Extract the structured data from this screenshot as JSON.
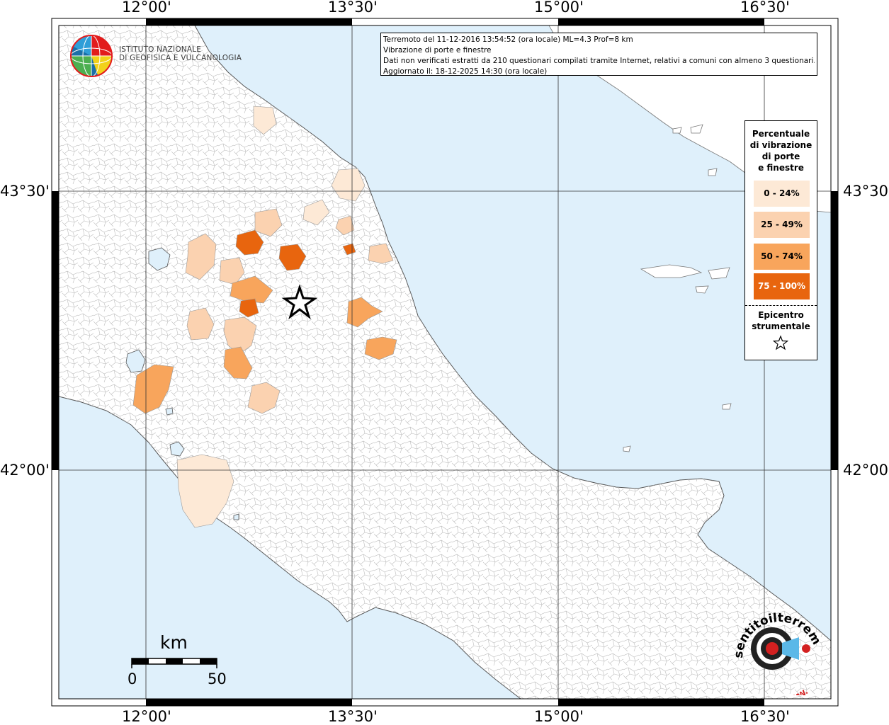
{
  "title_box": {
    "line1": "Terremoto del 11-12-2016 13:54:52 (ora locale) ML=4.3 Prof=8 km",
    "line2": "Vibrazione di porte e finestre",
    "line3": "Dati non verificati estratti da 210 questionari compilati tramite Internet, relativi a comuni con almeno 3 questionari.",
    "line4": "Aggiornato il: 18-12-2025 14:30 (ora locale)"
  },
  "logo": {
    "line1": "ISTITUTO NAZIONALE",
    "line2": "DI GEOFISICA E VULCANOLOGIA"
  },
  "axes": {
    "top": [
      "12°00'",
      "13°30'",
      "15°00'",
      "16°30'"
    ],
    "bottom": [
      "12°00'",
      "13°30'",
      "15°00'",
      "16°30'"
    ],
    "left": [
      "43°30'",
      "42°00'"
    ],
    "right": [
      "43°30'",
      "42°00'"
    ]
  },
  "legend": {
    "title": [
      "Percentuale",
      "di vibrazione",
      "di porte",
      "e finestre"
    ],
    "classes": [
      {
        "label": "0 - 24%",
        "color": "#fde9d6"
      },
      {
        "label": "25 - 49%",
        "color": "#fbd2b0"
      },
      {
        "label": "50 - 74%",
        "color": "#f8a55c"
      },
      {
        "label": "75 - 100%",
        "color": "#e8650e"
      }
    ],
    "epicenter_title": [
      "Epicentro",
      "strumentale"
    ],
    "epicenter_symbol": "star-icon"
  },
  "scale_bar": {
    "unit": "km",
    "min_label": "0",
    "max_label": "50"
  },
  "badge": {
    "text": "sentitoilterremoto.it",
    "www": "WWW."
  },
  "colors": {
    "sea": "#dff0fb",
    "land": "#ffffff",
    "boundary": "#b5b5b5",
    "frame": "#000000",
    "grid": "#333333"
  }
}
